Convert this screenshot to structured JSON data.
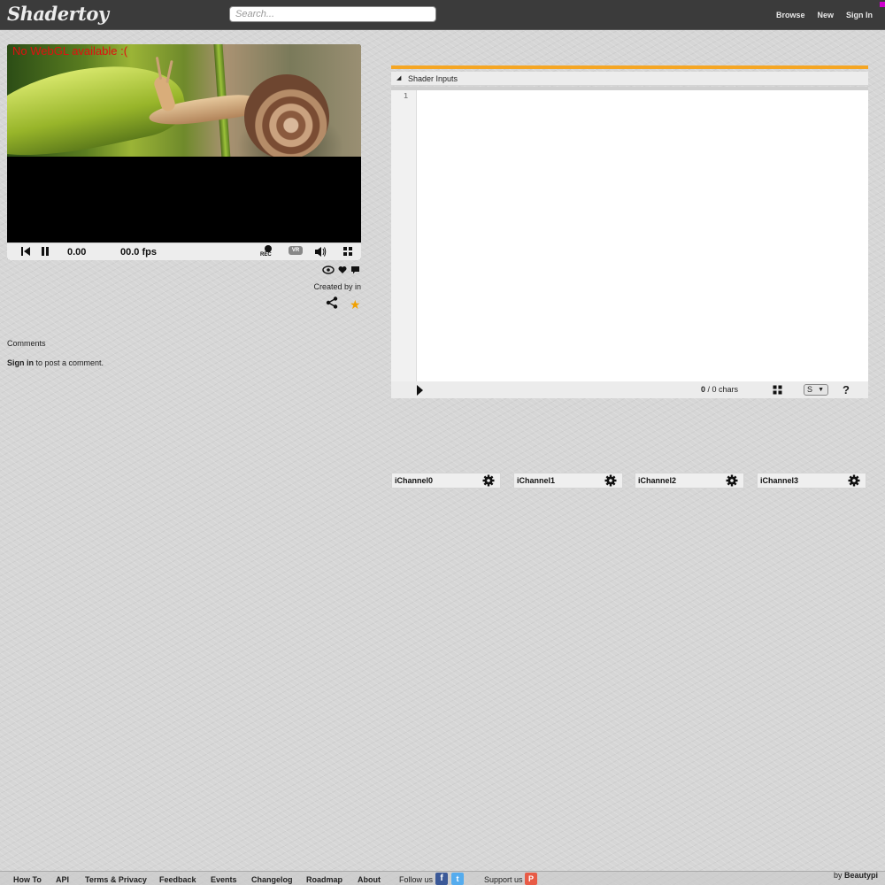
{
  "header": {
    "logo": "Shadertoy",
    "search_placeholder": "Search...",
    "nav": [
      "Browse",
      "New",
      "Sign In"
    ]
  },
  "player": {
    "error_text": "No WebGL available :(",
    "time": "0.00",
    "fps": "00.0 fps",
    "rec_label": "REC",
    "vr_label": "VR"
  },
  "info": {
    "created_by": "Created by  in"
  },
  "comments": {
    "title": "Comments",
    "signin_link": "Sign in",
    "signin_rest": " to post a comment."
  },
  "editor": {
    "inputs_label": "Shader Inputs",
    "line_number": "1",
    "chars_count": "0",
    "chars_rest": " / 0 chars",
    "select_value": "S",
    "help": "?",
    "accent_color": "#f5a623"
  },
  "channels": [
    "iChannel0",
    "iChannel1",
    "iChannel2",
    "iChannel3"
  ],
  "footer": {
    "links": [
      "How To",
      "API",
      "Terms & Privacy",
      "Feedback",
      "Events",
      "Changelog",
      "Roadmap",
      "About"
    ],
    "follow": "Follow us",
    "support": "Support us",
    "by": "by ",
    "author": "Beautypi"
  }
}
